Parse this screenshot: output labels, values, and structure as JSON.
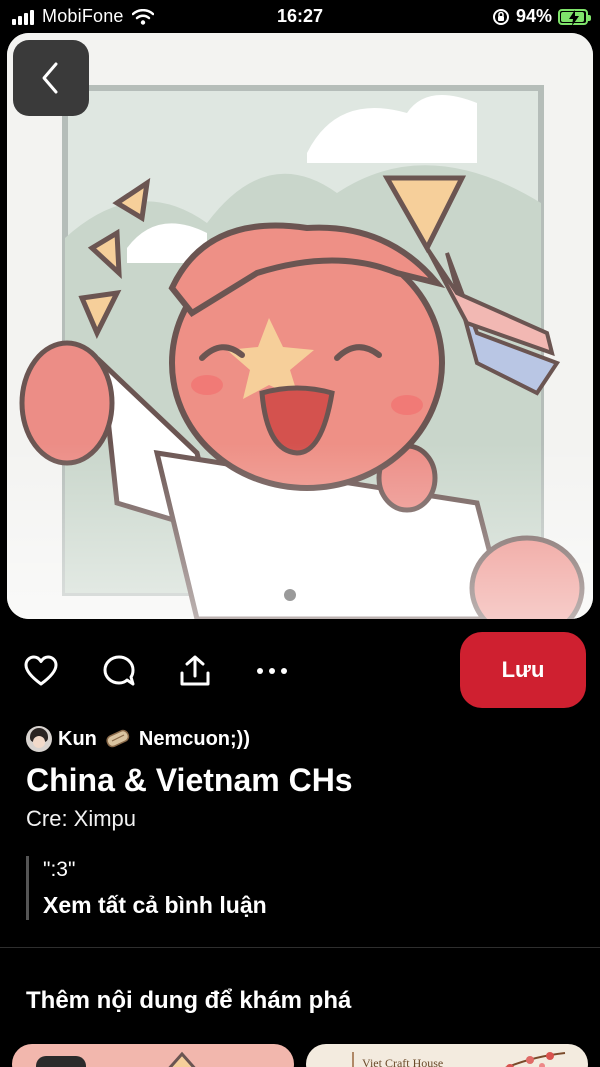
{
  "status_bar": {
    "carrier": "MobiFone",
    "time": "16:27",
    "battery_percent": "94%",
    "battery_level": 0.94
  },
  "pin": {
    "page_count": 2,
    "active_page": 2
  },
  "actions": {
    "save_label": "Lưu"
  },
  "author": {
    "name_part1": "Kun",
    "name_part2": "Nemcuon;))"
  },
  "details": {
    "title": "China & Vietnam CHs",
    "description": "Cre: Ximpu",
    "top_comment": "\":3\"",
    "see_all_comments": "Xem tất cả bình luận"
  },
  "explore": {
    "title": "Thêm nội dung để khám phá",
    "card2_text": "Viet Craft House"
  },
  "icons": [
    "back-icon",
    "heart-icon",
    "comment-icon",
    "share-icon",
    "more-icon",
    "wifi-icon",
    "rotation-lock-icon",
    "battery-icon"
  ],
  "colors": {
    "save_button": "#cf2030",
    "battery": "#7fe36b",
    "background": "#000000"
  }
}
